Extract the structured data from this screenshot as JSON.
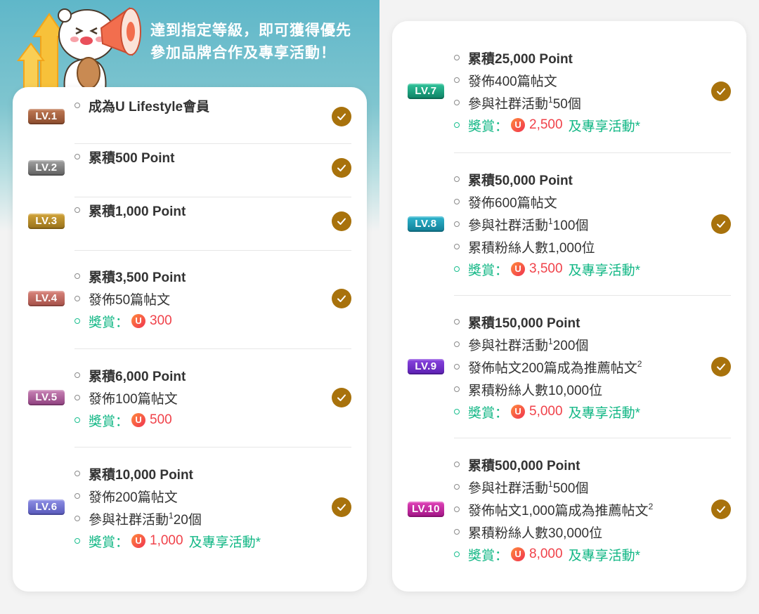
{
  "header": {
    "line1": "達到指定等級，即可獲得優先",
    "line2": "參加品牌合作及專享活動！"
  },
  "colors": {
    "check": "#a8720c",
    "reward_green": "#12b785",
    "reward_red": "#f0424a"
  },
  "icons": {
    "check": "check-icon",
    "coin": "u-coin-icon",
    "hero": "bear-megaphone-illustration"
  },
  "coin_letter": "U",
  "levels": [
    {
      "badge": "LV.1",
      "completed": true,
      "items": [
        {
          "text": "成為U Lifestyle會員",
          "bold": true
        }
      ]
    },
    {
      "badge": "LV.2",
      "completed": true,
      "items": [
        {
          "text": "累積500 Point",
          "bold": true
        }
      ]
    },
    {
      "badge": "LV.3",
      "completed": true,
      "items": [
        {
          "text": "累積1,000 Point",
          "bold": true
        }
      ]
    },
    {
      "badge": "LV.4",
      "completed": true,
      "items": [
        {
          "text": "累積3,500 Point",
          "bold": true
        },
        {
          "text": "發佈50篇帖文"
        }
      ],
      "reward": {
        "label": "獎賞：",
        "amount": "300",
        "extra": ""
      }
    },
    {
      "badge": "LV.5",
      "completed": true,
      "items": [
        {
          "text": "累積6,000 Point",
          "bold": true
        },
        {
          "text": "發佈100篇帖文"
        }
      ],
      "reward": {
        "label": "獎賞：",
        "amount": "500",
        "extra": ""
      }
    },
    {
      "badge": "LV.6",
      "completed": true,
      "items": [
        {
          "text": "累積10,000 Point",
          "bold": true
        },
        {
          "text": "發佈200篇帖文"
        },
        {
          "text": "參與社群活動",
          "sup": "1",
          "after": "20個"
        }
      ],
      "reward": {
        "label": "獎賞：",
        "amount": "1,000",
        "extra": "及專享活動*"
      }
    },
    {
      "badge": "LV.7",
      "completed": true,
      "items": [
        {
          "text": "累積25,000 Point",
          "bold": true
        },
        {
          "text": "發佈400篇帖文"
        },
        {
          "text": "參與社群活動",
          "sup": "1",
          "after": "50個"
        }
      ],
      "reward": {
        "label": "獎賞：",
        "amount": "2,500",
        "extra": "及專享活動*"
      }
    },
    {
      "badge": "LV.8",
      "completed": true,
      "items": [
        {
          "text": "累積50,000 Point",
          "bold": true
        },
        {
          "text": "發佈600篇帖文"
        },
        {
          "text": "參與社群活動",
          "sup": "1",
          "after": "100個"
        },
        {
          "text": "累積粉絲人數1,000位"
        }
      ],
      "reward": {
        "label": "獎賞：",
        "amount": "3,500",
        "extra": "及專享活動*"
      }
    },
    {
      "badge": "LV.9",
      "completed": true,
      "items": [
        {
          "text": "累積150,000 Point",
          "bold": true
        },
        {
          "text": "參與社群活動",
          "sup": "1",
          "after": "200個"
        },
        {
          "text": "發佈帖文200篇成為推薦帖文",
          "sup": "2",
          "after": ""
        },
        {
          "text": "累積粉絲人數10,000位"
        }
      ],
      "reward": {
        "label": "獎賞：",
        "amount": "5,000",
        "extra": "及專享活動*"
      }
    },
    {
      "badge": "LV.10",
      "completed": true,
      "items": [
        {
          "text": "累積500,000 Point",
          "bold": true
        },
        {
          "text": "參與社群活動",
          "sup": "1",
          "after": "500個"
        },
        {
          "text": "發佈帖文1,000篇成為推薦帖文",
          "sup": "2",
          "after": ""
        },
        {
          "text": "累積粉絲人數30,000位"
        }
      ],
      "reward": {
        "label": "獎賞：",
        "amount": "8,000",
        "extra": "及專享活動*"
      }
    }
  ]
}
